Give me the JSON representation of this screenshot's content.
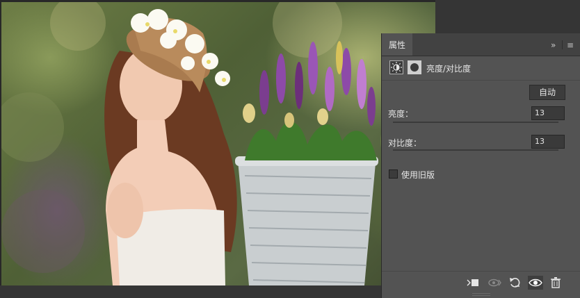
{
  "panel": {
    "tab_label": "属性",
    "expand_glyph": "»",
    "menu_glyph": "≡",
    "adjustment_title": "亮度/对比度",
    "auto_label": "自动",
    "brightness": {
      "label": "亮度：",
      "value": "13",
      "fraction": 0.54
    },
    "contrast": {
      "label": "对比度：",
      "value": "13",
      "fraction": 0.565
    },
    "legacy_label": "使用旧版",
    "legacy_checked": false
  },
  "footer_icons": [
    "clip-to-layer-icon",
    "view-previous-state-icon",
    "reset-icon",
    "visibility-eye-icon",
    "trash-icon"
  ],
  "colors": {
    "panel_bg": "#535353",
    "tab_bar": "#424242",
    "input_bg": "#3a3a3a",
    "text": "#e6e6e6"
  }
}
